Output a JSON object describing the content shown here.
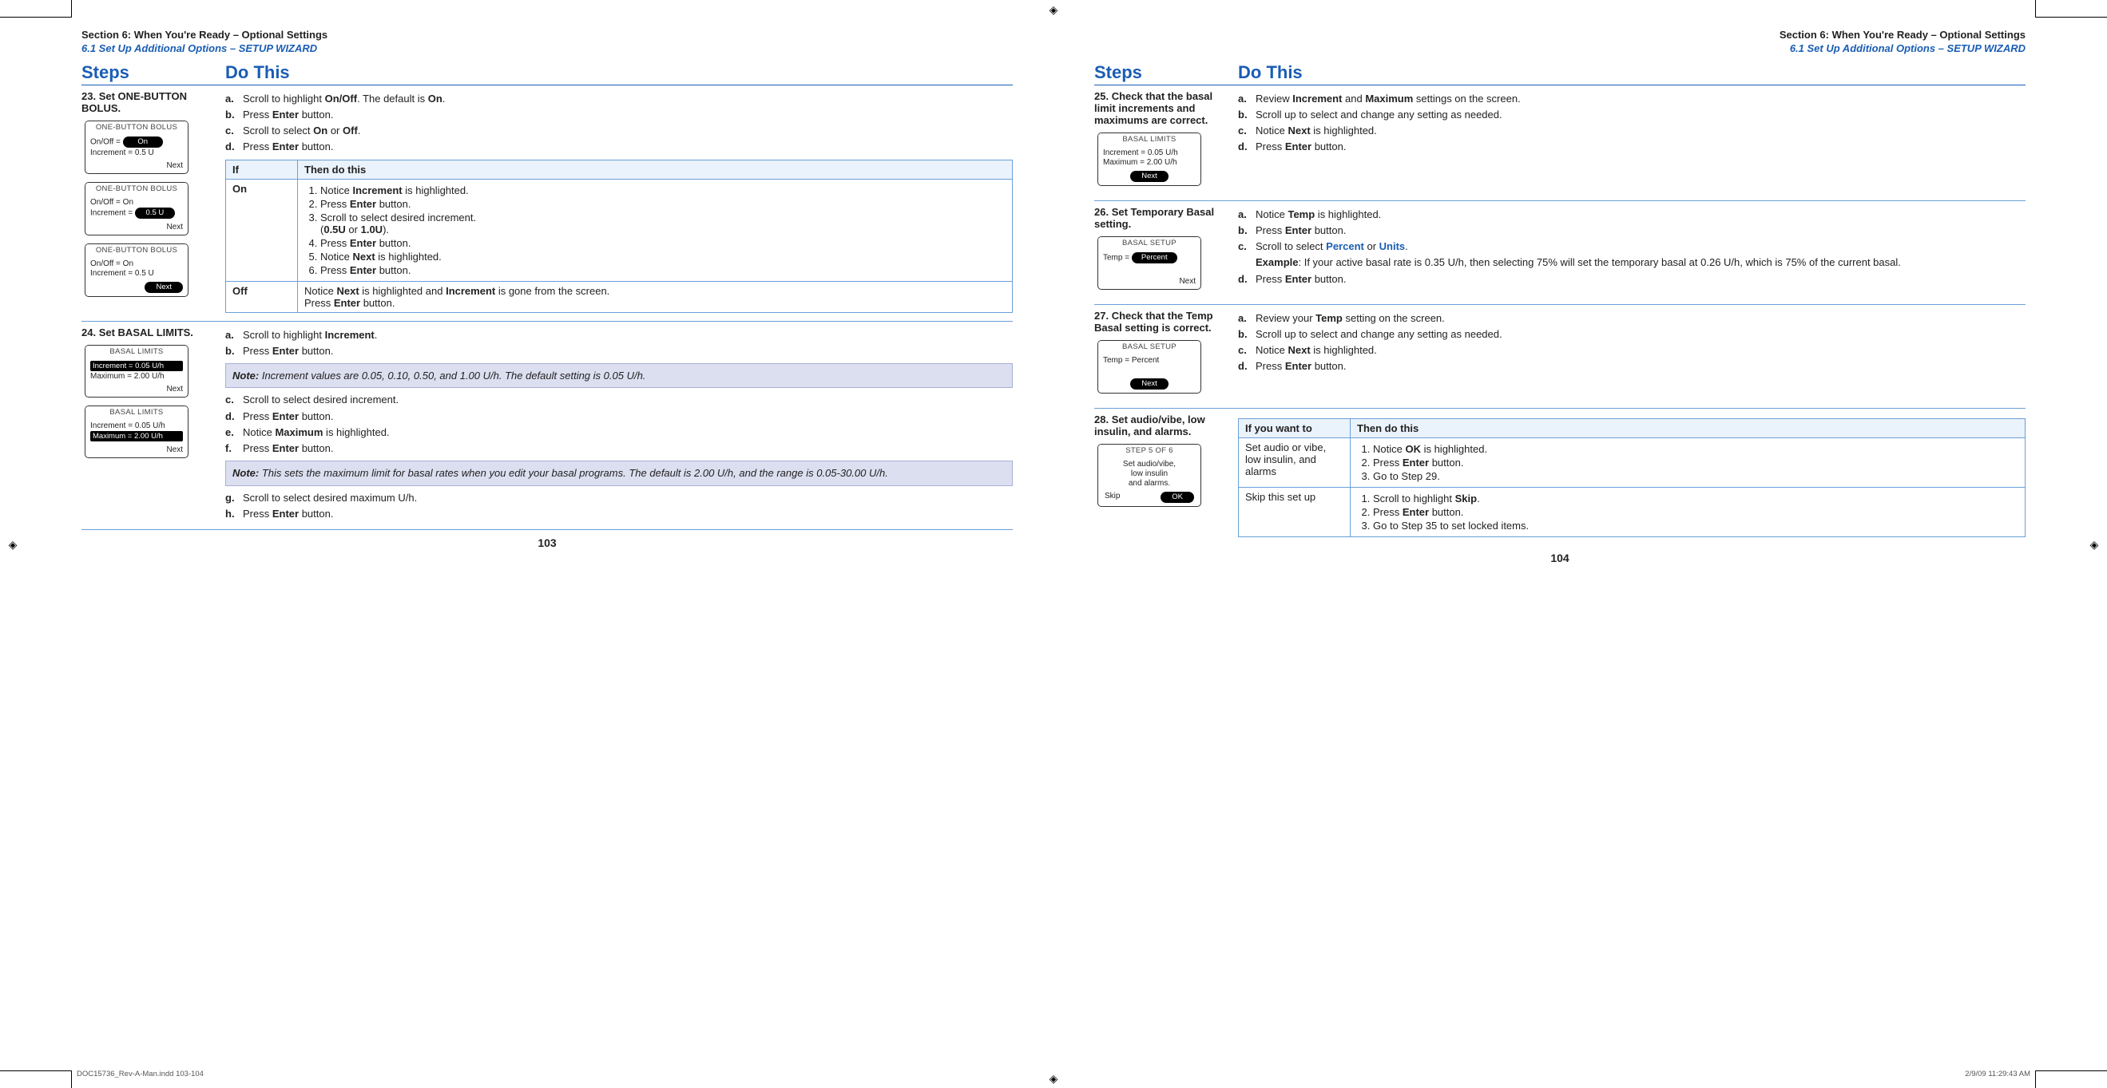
{
  "section_header": {
    "title": "Section 6: When You're Ready – Optional Settings",
    "subtitle": "6.1 Set Up Additional Options – SETUP WIZARD"
  },
  "columns": {
    "steps": "Steps",
    "do_this": "Do This"
  },
  "table_headers": {
    "if": "If",
    "then": "Then do this",
    "want": "If you want to"
  },
  "left": {
    "step23": {
      "num": "23.",
      "title": "Set ONE-BUTTON BOLUS.",
      "a_pre": "Scroll to highlight ",
      "a_bold": "On/Off",
      "a_post": ". The default is ",
      "a_bold2": "On",
      "a_end": ".",
      "b_pre": "Press ",
      "b_bold": "Enter",
      "b_post": " button.",
      "c_pre": "Scroll to select ",
      "c_bold1": "On",
      "c_mid": " or ",
      "c_bold2": "Off",
      "c_end": ".",
      "d_pre": "Press ",
      "d_bold": "Enter",
      "d_post": " button.",
      "if_on": "On",
      "on1_pre": "Notice ",
      "on1_bold": "Increment",
      "on1_post": " is highlighted.",
      "on2_pre": "Press ",
      "on2_bold": "Enter",
      "on2_post": " button.",
      "on3": "Scroll to select desired increment.",
      "on3_paren_pre": "(",
      "on3_b1": "0.5U",
      "on3_or": " or ",
      "on3_b2": "1.0U",
      "on3_paren_post": ").",
      "on4_pre": "Press ",
      "on4_bold": "Enter",
      "on4_post": " button.",
      "on5_pre": "Notice ",
      "on5_bold": "Next",
      "on5_post": " is highlighted.",
      "on6_pre": "Press ",
      "on6_bold": "Enter",
      "on6_post": " button.",
      "if_off": "Off",
      "off_pre": "Notice ",
      "off_b1": "Next",
      "off_mid": " is highlighted and ",
      "off_b2": "Increment",
      "off_post": " is gone from the screen.",
      "off_press_pre": "Press ",
      "off_press_b": "Enter",
      "off_press_post": " button.",
      "dev1": {
        "title": "ONE-BUTTON BOLUS",
        "row1_label": "On/Off =",
        "row1_pill": "On",
        "row2": "Increment = 0.5 U",
        "footer": "Next"
      },
      "dev2": {
        "title": "ONE-BUTTON BOLUS",
        "row1": "On/Off = On",
        "row2_label": "Increment =",
        "row2_pill": "0.5 U",
        "footer": "Next"
      },
      "dev3": {
        "title": "ONE-BUTTON BOLUS",
        "row1": "On/Off = On",
        "row2": "Increment = 0.5 U",
        "footer_pill": "Next"
      }
    },
    "step24": {
      "num": "24.",
      "title": "Set BASAL LIMITS.",
      "a_pre": "Scroll to highlight ",
      "a_bold": "Increment",
      "a_end": ".",
      "b_pre": "Press ",
      "b_bold": "Enter",
      "b_post": " button.",
      "note1_label": "Note:",
      "note1_text": " Increment values are 0.05, 0.10, 0.50, and 1.00 U/h. The default setting is 0.05 U/h.",
      "c": "Scroll to select desired increment.",
      "d_pre": "Press ",
      "d_bold": "Enter",
      "d_post": " button.",
      "e_pre": "Notice ",
      "e_bold": "Maximum",
      "e_post": " is highlighted.",
      "f_pre": "Press ",
      "f_bold": "Enter",
      "f_post": " button.",
      "note2_label": "Note:",
      "note2_text": " This sets the maximum limit for basal rates when you edit your basal programs. The default is 2.00 U/h, and the range is 0.05-30.00 U/h.",
      "g": "Scroll to select desired maximum U/h.",
      "h_pre": "Press ",
      "h_bold": "Enter",
      "h_post": " button.",
      "dev1": {
        "title": "BASAL LIMITS",
        "row1_hl": "Increment = 0.05 U/h",
        "row2": "Maximum = 2.00 U/h",
        "footer": "Next"
      },
      "dev2": {
        "title": "BASAL LIMITS",
        "row1": "Increment = 0.05 U/h",
        "row2_hl": "Maximum = 2.00 U/h",
        "footer": "Next"
      }
    },
    "page_num": "103"
  },
  "right": {
    "step25": {
      "num": "25.",
      "title": "Check that the basal limit increments and maximums are correct.",
      "a_pre": "Review ",
      "a_b1": "Increment",
      "a_mid": " and ",
      "a_b2": "Maximum",
      "a_post": " settings on the screen.",
      "b": "Scroll up to select and change any setting as needed.",
      "c_pre": "Notice ",
      "c_bold": "Next",
      "c_post": " is highlighted.",
      "d_pre": "Press ",
      "d_bold": "Enter",
      "d_post": " button.",
      "dev": {
        "title": "BASAL LIMITS",
        "row1": "Increment = 0.05 U/h",
        "row2": "Maximum = 2.00 U/h",
        "footer_pill": "Next"
      }
    },
    "step26": {
      "num": "26.",
      "title": "Set Temporary Basal setting.",
      "a_pre": "Notice ",
      "a_bold": "Temp",
      "a_post": " is highlighted.",
      "b_pre": "Press ",
      "b_bold": "Enter",
      "b_post": " button.",
      "c_pre": "Scroll to select ",
      "c_link1": "Percent",
      "c_mid": " or ",
      "c_link2": "Units",
      "c_end": ".",
      "ex_label": "Example",
      "ex_text": ": If your active basal rate is 0.35 U/h, then selecting 75% will set the temporary basal at 0.26 U/h, which is 75% of the current basal.",
      "d_pre": "Press ",
      "d_bold": "Enter",
      "d_post": " button.",
      "dev": {
        "title": "BASAL SETUP",
        "row_label": "Temp =",
        "row_pill": "Percent",
        "footer": "Next"
      }
    },
    "step27": {
      "num": "27.",
      "title": "Check that the Temp Basal setting is correct.",
      "a_pre": "Review your ",
      "a_bold": "Temp",
      "a_post": " setting on the screen.",
      "b": "Scroll up to select and change any setting as needed.",
      "c_pre": "Notice ",
      "c_bold": "Next",
      "c_post": " is highlighted.",
      "d_pre": "Press ",
      "d_bold": "Enter",
      "d_post": " button.",
      "dev": {
        "title": "BASAL SETUP",
        "row": "Temp = Percent",
        "footer_pill": "Next"
      }
    },
    "step28": {
      "num": "28.",
      "title": "Set audio/vibe, low insulin, and alarms.",
      "want1": "Set audio or vibe, low insulin, and alarms",
      "w1_1_pre": "Notice ",
      "w1_1_bold": "OK",
      "w1_1_post": " is highlighted.",
      "w1_2_pre": "Press ",
      "w1_2_bold": "Enter",
      "w1_2_post": " button.",
      "w1_3": "Go to Step 29.",
      "want2": "Skip this set up",
      "w2_1_pre": "Scroll to highlight ",
      "w2_1_bold": "Skip",
      "w2_1_post": ".",
      "w2_2_pre": "Press ",
      "w2_2_bold": "Enter",
      "w2_2_post": " button.",
      "w2_3": "Go to Step 35 to set locked items.",
      "dev": {
        "title": "STEP 5 OF 6",
        "l1": "Set audio/vibe,",
        "l2": "low insulin",
        "l3": "and alarms.",
        "skip": "Skip",
        "ok_pill": "OK"
      }
    },
    "page_num": "104"
  },
  "footer": {
    "slug": "DOC15736_Rev-A-Man.indd   103-104",
    "timestamp": "2/9/09   11:29:43 AM"
  }
}
